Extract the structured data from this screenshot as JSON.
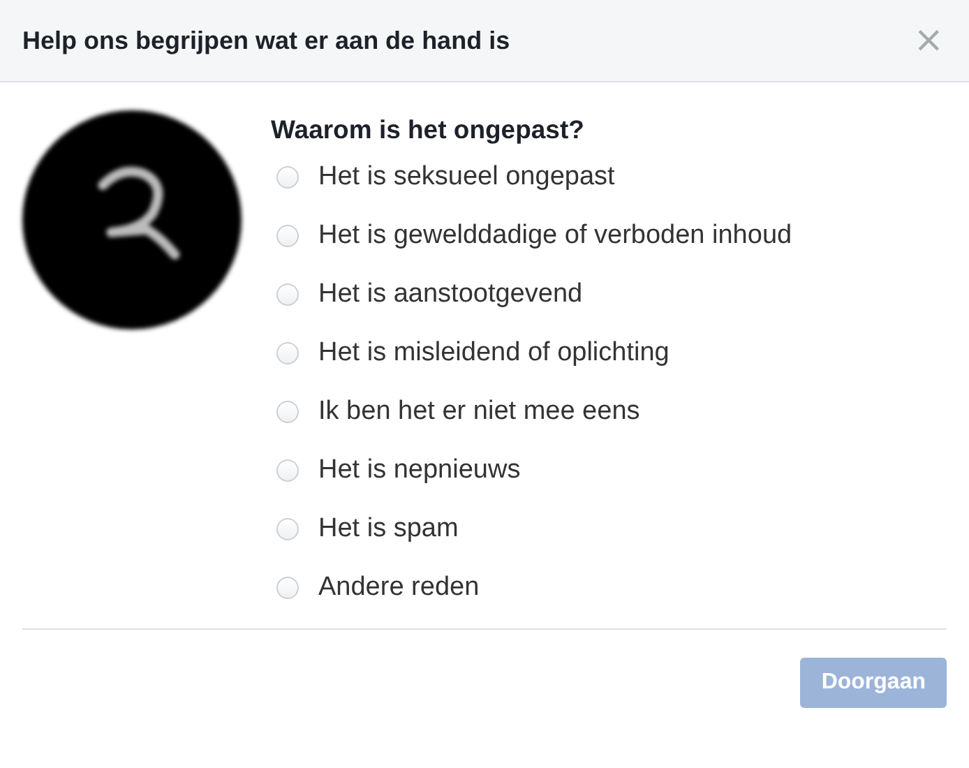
{
  "dialog": {
    "title": "Help ons begrijpen wat er aan de hand is",
    "close": "×"
  },
  "question": "Waarom is het ongepast?",
  "options": [
    {
      "label": "Het is seksueel ongepast",
      "selected": false
    },
    {
      "label": "Het is gewelddadige of verboden inhoud",
      "selected": false
    },
    {
      "label": "Het is aanstootgevend",
      "selected": false
    },
    {
      "label": "Het is misleidend of oplichting",
      "selected": false
    },
    {
      "label": "Ik ben het er niet mee eens",
      "selected": false
    },
    {
      "label": "Het is nepnieuws",
      "selected": false
    },
    {
      "label": "Het is spam",
      "selected": false
    },
    {
      "label": "Andere reden",
      "selected": false
    }
  ],
  "buttons": [
    {
      "label": "Doorgaan",
      "disabled": true
    }
  ]
}
